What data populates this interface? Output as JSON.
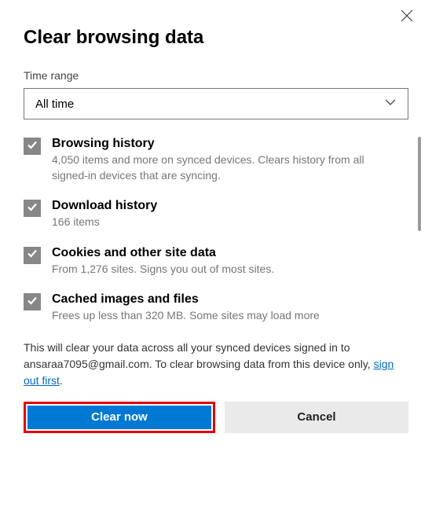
{
  "dialog": {
    "title": "Clear browsing data",
    "close_label": "Close"
  },
  "time_range": {
    "label": "Time range",
    "value": "All time"
  },
  "options": [
    {
      "title": "Browsing history",
      "desc": "4,050 items and more on synced devices. Clears history from all signed-in devices that are syncing.",
      "checked": true
    },
    {
      "title": "Download history",
      "desc": "166 items",
      "checked": true
    },
    {
      "title": "Cookies and other site data",
      "desc": "From 1,276 sites. Signs you out of most sites.",
      "checked": true
    },
    {
      "title": "Cached images and files",
      "desc": "Frees up less than 320 MB. Some sites may load more",
      "checked": true
    }
  ],
  "notice": {
    "prefix": "This will clear your data across all your synced devices signed in to ansaraa7095@gmail.com. To clear browsing data from this device only, ",
    "link": "sign out first",
    "suffix": "."
  },
  "buttons": {
    "primary": "Clear now",
    "secondary": "Cancel"
  }
}
